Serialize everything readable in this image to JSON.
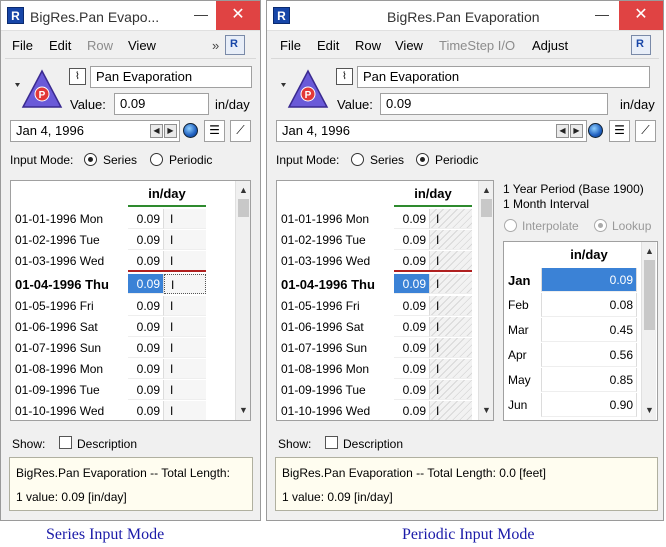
{
  "left_window": {
    "title": "BigRes.Pan Evapo...",
    "menus": [
      "File",
      "Edit",
      "Row",
      "View"
    ],
    "menu_disabled": [
      false,
      false,
      true,
      false
    ],
    "overflow": "»",
    "object_name": "Pan Evaporation",
    "value_label": "Value:",
    "value": "0.09",
    "units": "in/day",
    "date": "Jan 4, 1996",
    "input_mode_label": "Input Mode:",
    "mode_series": "Series",
    "mode_periodic": "Periodic",
    "selected_mode": "Series",
    "column_header": "in/day",
    "rows": [
      {
        "date": "01-01-1996 Mon",
        "value": "0.09",
        "flag": "I"
      },
      {
        "date": "01-02-1996 Tue",
        "value": "0.09",
        "flag": "I"
      },
      {
        "date": "01-03-1996 Wed",
        "value": "0.09",
        "flag": "I"
      },
      {
        "date": "01-04-1996 Thu",
        "value": "0.09",
        "flag": "I"
      },
      {
        "date": "01-05-1996 Fri",
        "value": "0.09",
        "flag": "I"
      },
      {
        "date": "01-06-1996 Sat",
        "value": "0.09",
        "flag": "I"
      },
      {
        "date": "01-07-1996 Sun",
        "value": "0.09",
        "flag": "I"
      },
      {
        "date": "01-08-1996 Mon",
        "value": "0.09",
        "flag": "I"
      },
      {
        "date": "01-09-1996 Tue",
        "value": "0.09",
        "flag": "I"
      },
      {
        "date": "01-10-1996 Wed",
        "value": "0.09",
        "flag": "I"
      }
    ],
    "current_row_index": 3,
    "show_label": "Show:",
    "description_label": "Description",
    "status_line1": "BigRes.Pan Evaporation -- Total Length:",
    "status_line2": "1 value:  0.09 [in/day]",
    "caption": "Series Input Mode"
  },
  "right_window": {
    "title": "BigRes.Pan Evaporation",
    "menus": [
      "File",
      "Edit",
      "Row",
      "View",
      "TimeStep I/O",
      "Adjust"
    ],
    "menu_disabled": [
      false,
      false,
      false,
      false,
      true,
      false
    ],
    "object_name": "Pan Evaporation",
    "value_label": "Value:",
    "value": "0.09",
    "units": "in/day",
    "date": "Jan 4, 1996",
    "input_mode_label": "Input Mode:",
    "mode_series": "Series",
    "mode_periodic": "Periodic",
    "selected_mode": "Periodic",
    "column_header": "in/day",
    "rows": [
      {
        "date": "01-01-1996 Mon",
        "value": "0.09",
        "flag": "I"
      },
      {
        "date": "01-02-1996 Tue",
        "value": "0.09",
        "flag": "I"
      },
      {
        "date": "01-03-1996 Wed",
        "value": "0.09",
        "flag": "I"
      },
      {
        "date": "01-04-1996 Thu",
        "value": "0.09",
        "flag": "I"
      },
      {
        "date": "01-05-1996 Fri",
        "value": "0.09",
        "flag": "I"
      },
      {
        "date": "01-06-1996 Sat",
        "value": "0.09",
        "flag": "I"
      },
      {
        "date": "01-07-1996 Sun",
        "value": "0.09",
        "flag": "I"
      },
      {
        "date": "01-08-1996 Mon",
        "value": "0.09",
        "flag": "I"
      },
      {
        "date": "01-09-1996 Tue",
        "value": "0.09",
        "flag": "I"
      },
      {
        "date": "01-10-1996 Wed",
        "value": "0.09",
        "flag": "I"
      }
    ],
    "current_row_index": 3,
    "period_line1": "1 Year Period (Base 1900)",
    "period_line2": "1 Month Interval",
    "interpolate_label": "Interpolate",
    "lookup_label": "Lookup",
    "periodic_header": "in/day",
    "periodic_rows": [
      {
        "month": "Jan",
        "value": "0.09"
      },
      {
        "month": "Feb",
        "value": "0.08"
      },
      {
        "month": "Mar",
        "value": "0.45"
      },
      {
        "month": "Apr",
        "value": "0.56"
      },
      {
        "month": "May",
        "value": "0.85"
      },
      {
        "month": "Jun",
        "value": "0.90"
      }
    ],
    "show_label": "Show:",
    "description_label": "Description",
    "status_line1": "BigRes.Pan Evaporation -- Total Length: 0.0 [feet]",
    "status_line2": "1 value:  0.09 [in/day]",
    "caption": "Periodic Input Mode"
  },
  "icons": {
    "app": "app-icon",
    "object": "reservoir-triangle-icon",
    "series_slot": "slot-graph-icon",
    "prev": "prev-arrow-icon",
    "next": "next-arrow-icon",
    "globe": "globe-icon",
    "list": "list-icon",
    "plot": "plot-icon"
  },
  "colors": {
    "accent_selection": "#3b82d6",
    "close_button": "#e04343",
    "header_underline": "#2e8a2e",
    "current_row_line": "#b02020",
    "object_triangle": "#6a5ad8",
    "caption": "#1a1aa8"
  }
}
